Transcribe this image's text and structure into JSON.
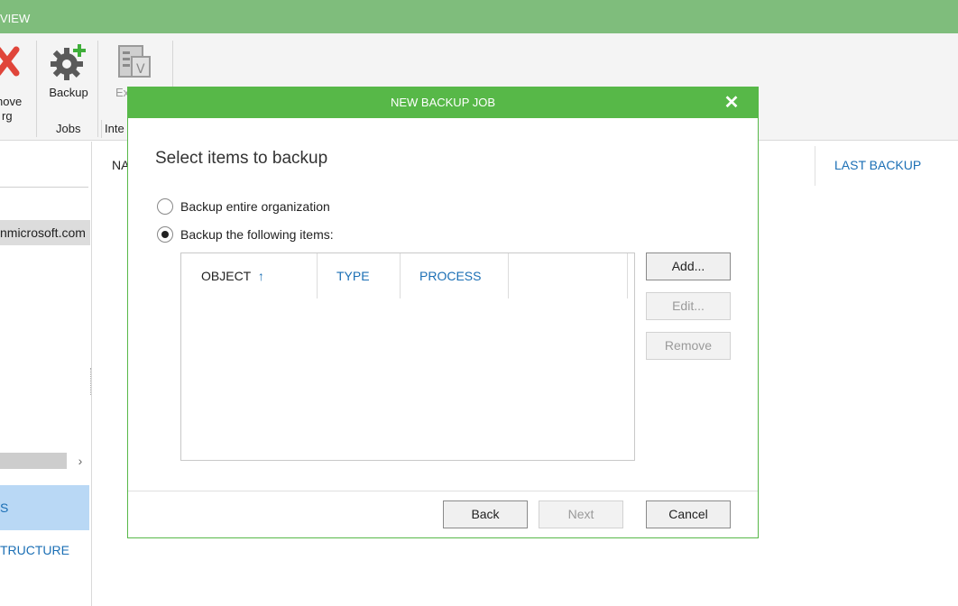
{
  "app": {
    "tab_label": "VIEW"
  },
  "ribbon": {
    "remove_label_line1": "nove",
    "remove_label_line2": "rg",
    "backup_label": "Backup",
    "jobs_group": "Jobs",
    "ext_label": "Ex",
    "inte_group": "Inte"
  },
  "leftnav": {
    "org_item": "nmicrosoft.com",
    "selected_item": "S",
    "infra_item": "TRUCTURE"
  },
  "main": {
    "col_name_partial": "NA",
    "col_last_backup": "LAST BACKUP"
  },
  "dialog": {
    "title": "NEW BACKUP JOB",
    "close_glyph": "✕",
    "heading": "Select items to backup",
    "radio_entire": "Backup entire organization",
    "radio_following": "Backup the following items:",
    "radio_selected": "following",
    "table": {
      "columns": [
        "OBJECT",
        "TYPE",
        "PROCESS"
      ],
      "sort_arrow": "↑",
      "rows": []
    },
    "buttons": {
      "add": "Add...",
      "edit": "Edit...",
      "remove": "Remove",
      "back": "Back",
      "next": "Next",
      "cancel": "Cancel"
    }
  },
  "colors": {
    "ribbon_green": "#7fbd7c",
    "dialog_green": "#57b848",
    "link_blue": "#1b6fb5",
    "remove_red": "#e0453a"
  }
}
